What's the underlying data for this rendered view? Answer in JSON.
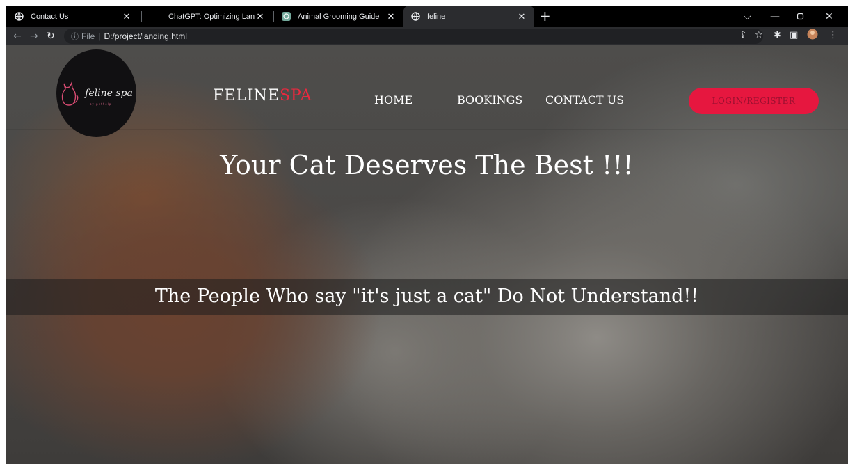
{
  "browser": {
    "tabs": [
      {
        "title": "Contact Us",
        "icon": "globe-icon"
      },
      {
        "title": "ChatGPT: Optimizing Language M",
        "icon": "chatgpt-icon"
      },
      {
        "title": "Animal Grooming Guide",
        "icon": "chatgpt-icon"
      },
      {
        "title": "feline",
        "icon": "globe-icon",
        "active": true
      }
    ],
    "address": {
      "scheme_label": "File",
      "path": "D:/project/landing.html"
    }
  },
  "site": {
    "logo_text": "feline spa",
    "logo_subtext": "by pethelp",
    "brand_primary": "FELINE",
    "brand_accent": "SPA",
    "nav": [
      "HOME",
      "BOOKINGS",
      "CONTACT US"
    ],
    "login_label": "LOGIN/REGISTER",
    "hero_title": "Your Cat Deserves The Best !!!",
    "hero_tagline": "The People Who say \"it's just a cat\" Do Not Understand!!"
  },
  "colors": {
    "accent": "#e6173f",
    "accent_text": "#9b1030",
    "brand_accent": "#e8293f"
  }
}
